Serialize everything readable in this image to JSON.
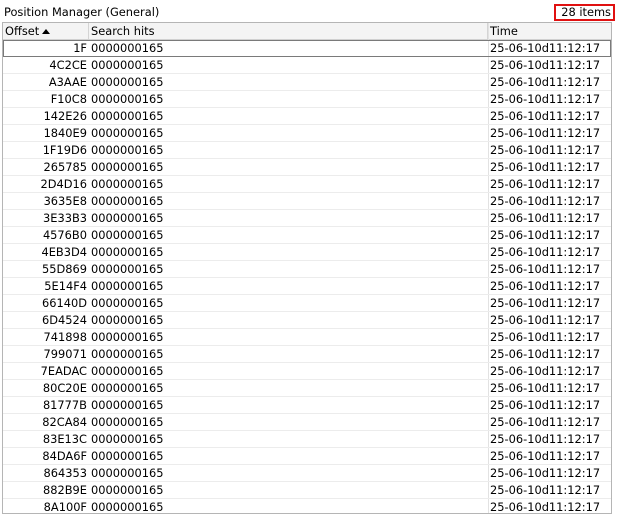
{
  "panel": {
    "title": "Position Manager (General)",
    "item_count": "28 items"
  },
  "table": {
    "columns": {
      "offset": "Offset",
      "hits": "Search hits",
      "time": "Time"
    },
    "sort": {
      "column": "offset",
      "direction": "ascending"
    },
    "rows": [
      {
        "offset": "1F",
        "hits": "0000000165",
        "time": "25-06-10d11:12:17"
      },
      {
        "offset": "4C2CE",
        "hits": "0000000165",
        "time": "25-06-10d11:12:17"
      },
      {
        "offset": "A3AAE",
        "hits": "0000000165",
        "time": "25-06-10d11:12:17"
      },
      {
        "offset": "F10C8",
        "hits": "0000000165",
        "time": "25-06-10d11:12:17"
      },
      {
        "offset": "142E26",
        "hits": "0000000165",
        "time": "25-06-10d11:12:17"
      },
      {
        "offset": "1840E9",
        "hits": "0000000165",
        "time": "25-06-10d11:12:17"
      },
      {
        "offset": "1F19D6",
        "hits": "0000000165",
        "time": "25-06-10d11:12:17"
      },
      {
        "offset": "265785",
        "hits": "0000000165",
        "time": "25-06-10d11:12:17"
      },
      {
        "offset": "2D4D16",
        "hits": "0000000165",
        "time": "25-06-10d11:12:17"
      },
      {
        "offset": "3635E8",
        "hits": "0000000165",
        "time": "25-06-10d11:12:17"
      },
      {
        "offset": "3E33B3",
        "hits": "0000000165",
        "time": "25-06-10d11:12:17"
      },
      {
        "offset": "4576B0",
        "hits": "0000000165",
        "time": "25-06-10d11:12:17"
      },
      {
        "offset": "4EB3D4",
        "hits": "0000000165",
        "time": "25-06-10d11:12:17"
      },
      {
        "offset": "55D869",
        "hits": "0000000165",
        "time": "25-06-10d11:12:17"
      },
      {
        "offset": "5E14F4",
        "hits": "0000000165",
        "time": "25-06-10d11:12:17"
      },
      {
        "offset": "66140D",
        "hits": "0000000165",
        "time": "25-06-10d11:12:17"
      },
      {
        "offset": "6D4524",
        "hits": "0000000165",
        "time": "25-06-10d11:12:17"
      },
      {
        "offset": "741898",
        "hits": "0000000165",
        "time": "25-06-10d11:12:17"
      },
      {
        "offset": "799071",
        "hits": "0000000165",
        "time": "25-06-10d11:12:17"
      },
      {
        "offset": "7EADAC",
        "hits": "0000000165",
        "time": "25-06-10d11:12:17"
      },
      {
        "offset": "80C20E",
        "hits": "0000000165",
        "time": "25-06-10d11:12:17"
      },
      {
        "offset": "81777B",
        "hits": "0000000165",
        "time": "25-06-10d11:12:17"
      },
      {
        "offset": "82CA84",
        "hits": "0000000165",
        "time": "25-06-10d11:12:17"
      },
      {
        "offset": "83E13C",
        "hits": "0000000165",
        "time": "25-06-10d11:12:17"
      },
      {
        "offset": "84DA6F",
        "hits": "0000000165",
        "time": "25-06-10d11:12:17"
      },
      {
        "offset": "864353",
        "hits": "0000000165",
        "time": "25-06-10d11:12:17"
      },
      {
        "offset": "882B9E",
        "hits": "0000000165",
        "time": "25-06-10d11:12:17"
      },
      {
        "offset": "8A100F",
        "hits": "0000000165",
        "time": "25-06-10d11:12:17"
      }
    ]
  },
  "colors": {
    "badge_border": "#e01010",
    "header_background": "#f4f4f4"
  },
  "icons": {
    "sort": "sort-ascending-icon"
  }
}
